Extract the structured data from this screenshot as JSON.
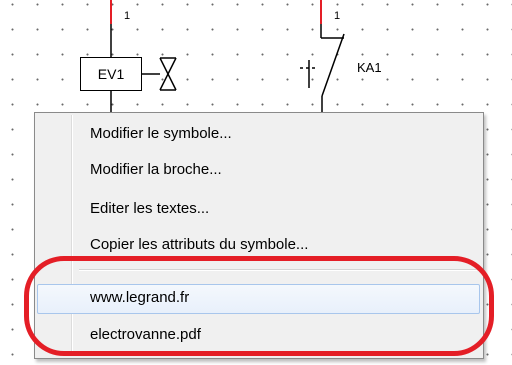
{
  "schematic": {
    "wire_label_left": "1",
    "wire_label_right": "1",
    "ev_label": "EV1",
    "ka_label": "KA1"
  },
  "context_menu": {
    "items": [
      {
        "label": "Modifier le symbole..."
      },
      {
        "label": "Modifier la broche..."
      },
      {
        "label": "Editer les textes..."
      },
      {
        "label": "Copier les attributs du symbole..."
      },
      {
        "label": "www.legrand.fr"
      },
      {
        "label": "electrovanne.pdf"
      }
    ]
  },
  "colors": {
    "wire": "#e41e26",
    "annotation": "#e41e26",
    "menu_background": "#f0f0f0",
    "hover_border": "#a8c6ec"
  }
}
